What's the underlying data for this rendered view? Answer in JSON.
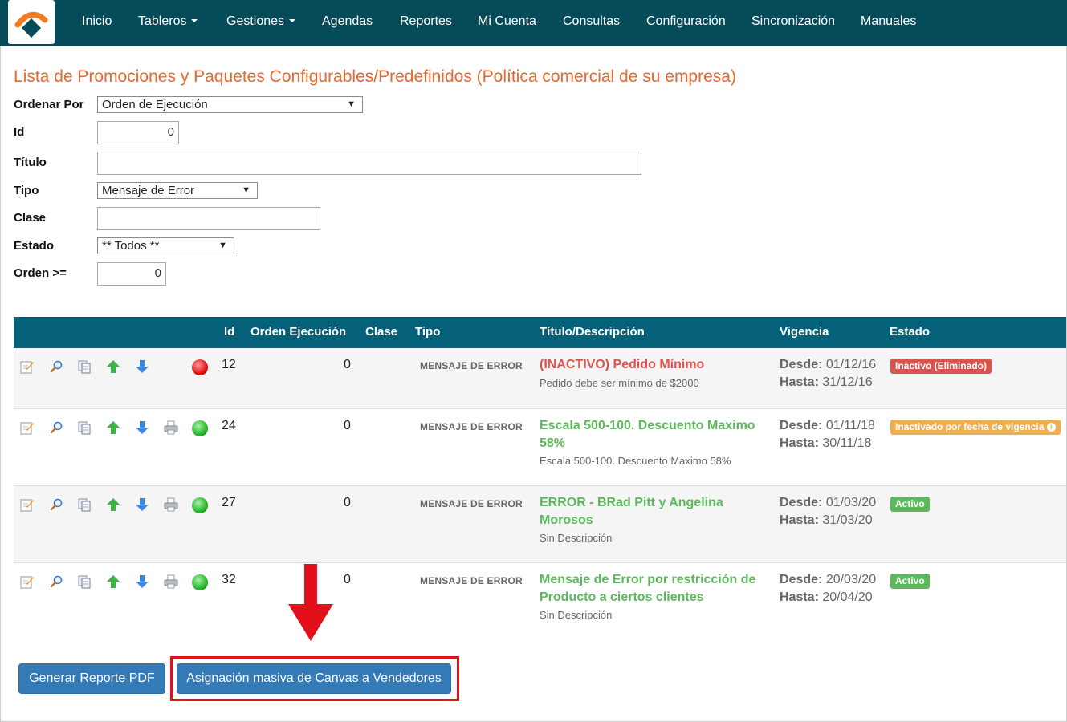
{
  "nav": {
    "items": [
      "Inicio",
      "Tableros",
      "Gestiones",
      "Agendas",
      "Reportes",
      "Mi Cuenta",
      "Consultas",
      "Configuración",
      "Sincronización",
      "Manuales"
    ]
  },
  "page": {
    "title": "Lista de Promociones y Paquetes Configurables/Predefinidos (Política comercial de su empresa)"
  },
  "filters": {
    "ordenar_label": "Ordenar Por",
    "ordenar_value": "Orden de Ejecución",
    "id_label": "Id",
    "id_value": "0",
    "titulo_label": "Título",
    "titulo_value": "",
    "tipo_label": "Tipo",
    "tipo_value": "Mensaje de Error",
    "clase_label": "Clase",
    "clase_value": "",
    "estado_label": "Estado",
    "estado_value": "** Todos **",
    "orden_label": "Orden >=",
    "orden_value": "0"
  },
  "table": {
    "headers": [
      "Id",
      "Orden Ejecución",
      "Clase",
      "Tipo",
      "Título/Descripción",
      "Vigencia",
      "Estado"
    ],
    "desde_label": "Desde:",
    "hasta_label": "Hasta:",
    "rows": [
      {
        "id": "12",
        "orden": "0",
        "tipo": "MENSAJE DE ERROR",
        "title": "(INACTIVO) Pedido Mínimo",
        "desc": "Pedido debe ser mínimo de $2000",
        "desde": "01/12/16",
        "hasta": "31/12/16",
        "estado": "Inactivo (Eliminado)",
        "status_color": "red"
      },
      {
        "id": "24",
        "orden": "0",
        "tipo": "MENSAJE DE ERROR",
        "title": "Escala 500-100. Descuento Maximo 58%",
        "desc": "Escala 500-100. Descuento Maximo 58%",
        "desde": "01/11/18",
        "hasta": "30/11/18",
        "estado": "Inactivado por fecha de vigencia",
        "status_color": "green"
      },
      {
        "id": "27",
        "orden": "0",
        "tipo": "MENSAJE DE ERROR",
        "title": "ERROR - BRad Pitt y Angelina Morosos",
        "desc": "Sin Descripción",
        "desde": "01/03/20",
        "hasta": "31/03/20",
        "estado": "Activo",
        "status_color": "green"
      },
      {
        "id": "32",
        "orden": "0",
        "tipo": "MENSAJE DE ERROR",
        "title": "Mensaje de Error por restricción de Producto a ciertos clientes",
        "desc": "Sin Descripción",
        "desde": "20/03/20",
        "hasta": "20/04/20",
        "estado": "Activo",
        "status_color": "green"
      }
    ]
  },
  "buttons": {
    "pdf": "Generar Reporte PDF",
    "canvas": "Asignación masiva de Canvas a Vendedores"
  },
  "colors": {
    "navbar": "#064b5a",
    "table_header": "#05607a",
    "title": "#e8672d",
    "button": "#337ab7",
    "highlight": "#e3101c"
  }
}
